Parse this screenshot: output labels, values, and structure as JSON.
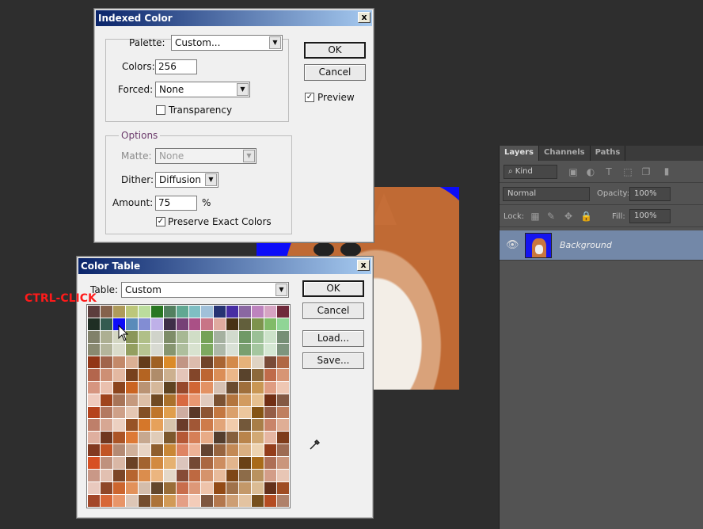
{
  "indexed": {
    "title": "Indexed Color",
    "palette_label": "Palette:",
    "palette_value": "Custom...",
    "colors_label": "Colors:",
    "colors_value": "256",
    "forced_label": "Forced:",
    "forced_value": "None",
    "transparency_label": "Transparency",
    "options_title": "Options",
    "matte_label": "Matte:",
    "matte_value": "None",
    "dither_label": "Dither:",
    "dither_value": "Diffusion",
    "amount_label": "Amount:",
    "amount_value": "75",
    "amount_unit": "%",
    "preserve_label": "Preserve Exact Colors",
    "ok": "OK",
    "cancel": "Cancel",
    "preview_label": "Preview",
    "close": "x"
  },
  "colortable": {
    "title": "Color Table",
    "table_label": "Table:",
    "table_value": "Custom",
    "ok": "OK",
    "cancel": "Cancel",
    "load": "Load...",
    "save": "Save...",
    "close": "x",
    "highlight_color": "#0c0cf8"
  },
  "annotation": "CTRL-CLICK",
  "layers": {
    "tabs": [
      "Layers",
      "Channels",
      "Paths"
    ],
    "kind_label": "Kind",
    "blend_mode": "Normal",
    "opacity_label": "Opacity:",
    "opacity_value": "100%",
    "lock_label": "Lock:",
    "fill_label": "Fill:",
    "fill_value": "100%",
    "layer_name": "Background"
  },
  "colors": {
    "accent_red": "#ff1a1a",
    "layer_selected": "#7388a8"
  }
}
